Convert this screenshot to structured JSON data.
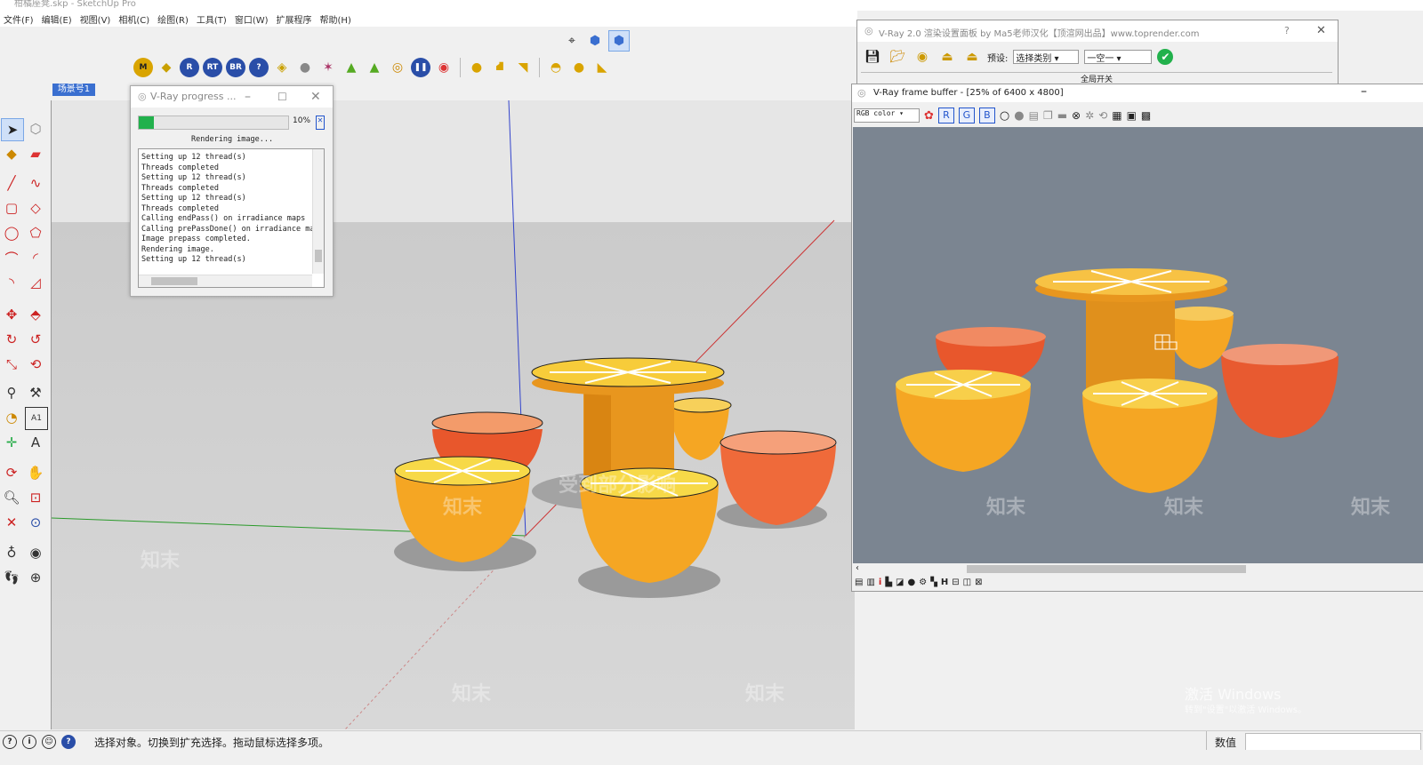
{
  "app": {
    "title": "柑橘座凳.skp - SketchUp Pro",
    "menus": [
      "文件(F)",
      "编辑(E)",
      "视图(V)",
      "相机(C)",
      "绘图(R)",
      "工具(T)",
      "窗口(W)",
      "扩展程序",
      "帮助(H)"
    ],
    "scene_tab": "场景号1"
  },
  "toolbar": {
    "vray_buttons": [
      "M",
      "R",
      "RT",
      "BR",
      "?"
    ]
  },
  "progress": {
    "title": "V-Ray progress ...",
    "percent_label": "10%",
    "percent": 10,
    "status": "Rendering image...",
    "log": [
      "Setting up 12 thread(s)",
      "Threads completed",
      "Setting up 12 thread(s)",
      "Threads completed",
      "Setting up 12 thread(s)",
      "Threads completed",
      "Calling endPass() on irradiance maps",
      "Calling prePassDone() on irradiance map",
      "Image prepass completed.",
      "Rendering image.",
      "Setting up 12 thread(s)"
    ]
  },
  "vray_panel": {
    "title": "V-Ray 2.0 渲染设置面板 by Ma5老师汉化【顶渲网出品】www.toprender.com",
    "preset_label": "预设:",
    "preset_value": "选择类别",
    "preset2_value": "一空一",
    "section": "全局开关",
    "help": "?"
  },
  "vfb": {
    "title": "V-Ray frame buffer - [25% of 6400 x 4800]",
    "channel_select": "RGB color",
    "channels": [
      "R",
      "G",
      "B"
    ]
  },
  "statusbar": {
    "message": "选择对象。切换到扩充选择。拖动鼠标选择多项。",
    "value_label": "数值"
  },
  "watermark": {
    "brand": "知末",
    "notice": "受到部分影响",
    "activate_title": "激活 Windows",
    "activate_sub": "转到\"设置\"以激活 Windows。"
  },
  "colors": {
    "orange": "#f5a623",
    "red_orange": "#ef6a3a",
    "accent": "#3a6fd0",
    "progress_fill": "#22b14c"
  }
}
